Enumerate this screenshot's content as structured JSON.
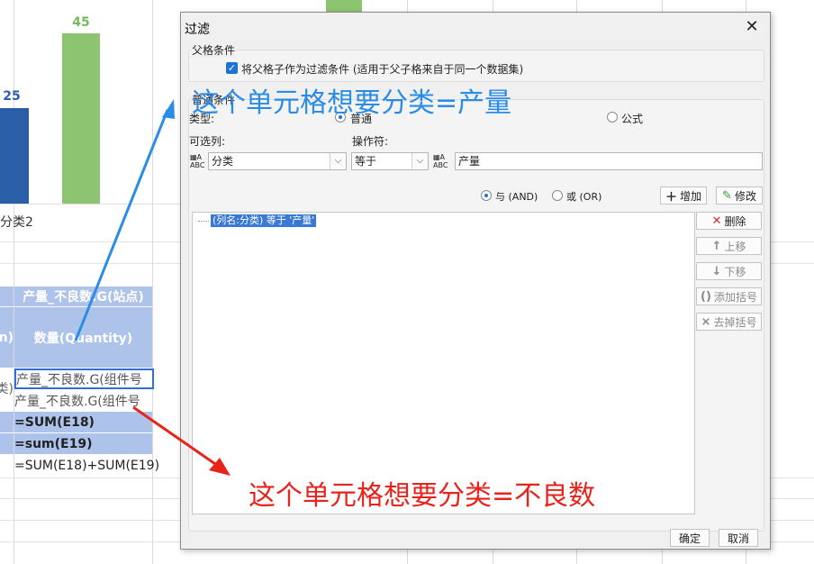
{
  "background": {
    "bars": [
      {
        "label": "25",
        "color": "#2a5fa8",
        "label_color": "#2a5fa8"
      },
      {
        "label": "45",
        "color": "#8dc470",
        "label_color": "#7ab85d"
      }
    ],
    "category_label": "分类2",
    "cells": {
      "header_row1": "产量_不良数.G(站点)",
      "header_left": "on)",
      "header_quantity": "数量(Quantity)",
      "row_left_frag": "类)",
      "row1": "产量_不良数.G(组件号",
      "row2": "产量_不良数.G(组件号",
      "sum1": "=SUM(E18)",
      "sum2": "=sum(E19)",
      "sum3": "=SUM(E18)+SUM(E19)"
    }
  },
  "dialog": {
    "title": "过滤",
    "parent_section": {
      "title": "父格条件",
      "checkbox_label": "将父格子作为过滤条件 (适用于父子格来自于同一个数据集)",
      "checked": true
    },
    "normal_section": {
      "title": "普通条件",
      "type_label": "类型:",
      "type_options": [
        "普通",
        "公式"
      ],
      "type_selected": "普通",
      "column_label": "可选列:",
      "column_value": "分类",
      "operator_label": "操作符:",
      "operator_value": "等于",
      "value_text": "产量",
      "logic_options": [
        "与 (AND)",
        "或 (OR)"
      ],
      "logic_selected": "与 (AND)"
    },
    "buttons": {
      "add": "增加",
      "modify": "修改",
      "delete": "删除",
      "move_up": "上移",
      "move_down": "下移",
      "add_bracket": "添加括号",
      "remove_bracket": "去掉括号",
      "ok": "确定",
      "cancel": "取消"
    },
    "condition_list": [
      "(列名:分类) 等于 '产量'"
    ]
  },
  "annotations": {
    "top_note": "这个单元格想要分类=产量",
    "top_note_color": "#2b8ce6",
    "bottom_note": "这个单元格想要分类=不良数",
    "bottom_note_color": "#e8231b"
  },
  "icons": {
    "close": "close-icon",
    "abc": "abc-field-icon",
    "add": "plus-icon",
    "modify": "edit-icon",
    "delete": "delete-x-icon",
    "up": "arrow-up-icon",
    "down": "arrow-down-icon",
    "bracket_add": "bracket-add-icon",
    "bracket_remove": "bracket-remove-icon"
  }
}
